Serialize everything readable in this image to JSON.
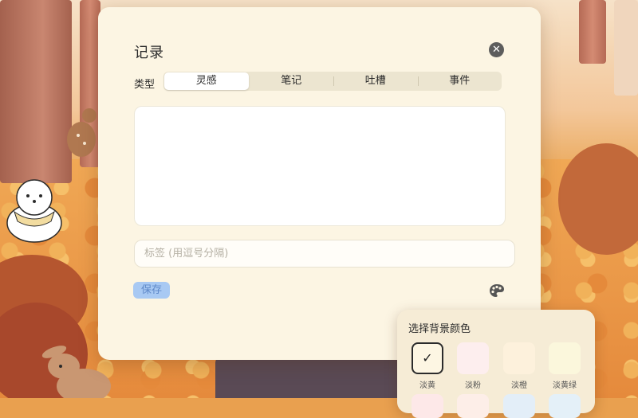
{
  "dialog": {
    "title": "记录",
    "close_icon": "close-icon",
    "type_label": "类型",
    "types": [
      {
        "label": "灵感",
        "selected": true
      },
      {
        "label": "笔记",
        "selected": false
      },
      {
        "label": "吐槽",
        "selected": false
      },
      {
        "label": "事件",
        "selected": false
      }
    ],
    "content_value": "",
    "tag_placeholder": "标签 (用逗号分隔)",
    "save_label": "保存",
    "palette_icon": "palette-icon"
  },
  "color_picker": {
    "title": "选择背景颜色",
    "swatches": [
      {
        "label": "淡黄",
        "color": "#fdf6e3",
        "selected": true
      },
      {
        "label": "淡粉",
        "color": "#fdeeee",
        "selected": false
      },
      {
        "label": "淡橙",
        "color": "#fdf1dc",
        "selected": false
      },
      {
        "label": "淡黄绿",
        "color": "#fbf7dc",
        "selected": false
      }
    ],
    "check_icon": "✓"
  }
}
